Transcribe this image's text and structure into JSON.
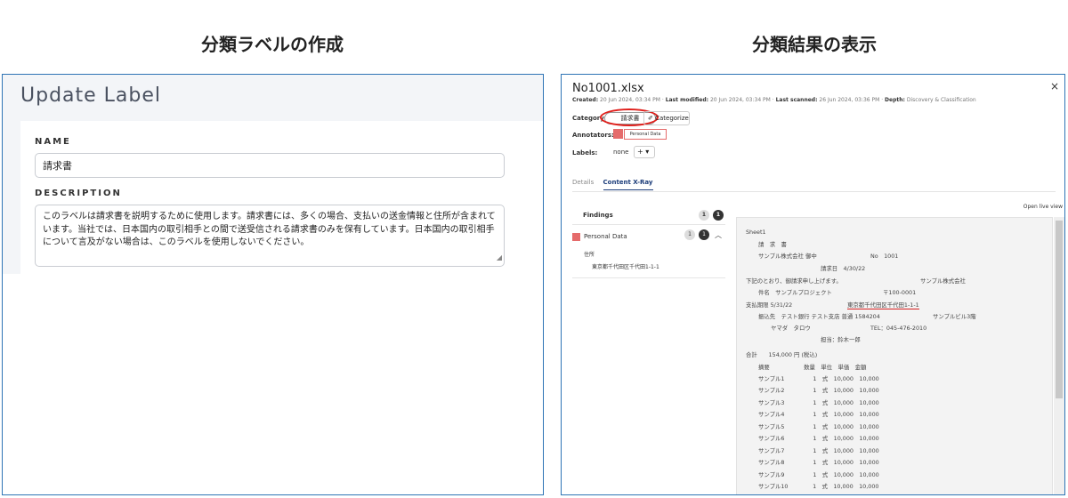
{
  "captions": {
    "left": "分類ラベルの作成",
    "right": "分類結果の表示"
  },
  "update_label": {
    "title": "Update Label",
    "name_label": "NAME",
    "name_value": "請求書",
    "description_label": "DESCRIPTION",
    "description_value": "このラベルは請求書を説明するために使用します。請求書には、多くの場合、支払いの送金情報と住所が含まれています。当社では、日本国内の取引相手との間で送受信される請求書のみを保有しています。日本国内の取引相手について言及がない場合は、このラベルを使用しないでください。"
  },
  "file_view": {
    "close": "×",
    "file_name": "No1001.xlsx",
    "meta": {
      "created_label": "Created:",
      "created": "20 Jun 2024, 03:34 PM",
      "modified_label": "Last modified:",
      "modified": "20 Jun 2024, 03:34 PM",
      "scanned_label": "Last scanned:",
      "scanned": "26 Jun 2024, 03:36 PM",
      "depth_label": "Depth:",
      "depth": "Discovery & Classification"
    },
    "category_label": "Category:",
    "category_value": "請求書",
    "categorize": "✐ Categorize",
    "annotators_label": "Annotators:",
    "annotator": "Personal Data",
    "labels_label": "Labels:",
    "labels_value": "none",
    "labels_add": "+ ▾",
    "tabs": [
      "Details",
      "Content X-Ray"
    ],
    "open_live_view": "Open live view",
    "findings": {
      "header": "Findings",
      "count_a": "1",
      "count_b": "1",
      "item_name": "Personal Data",
      "item_count_a": "1",
      "item_count_b": "1",
      "chevron": "︿",
      "address_label": "住所",
      "address_value": "東京都千代田区千代田1-1-1"
    },
    "document_lines": [
      "Sheet1",
      "請　求　書",
      "サンプル株式会社 御中",
      "No　1001",
      "請求日　4/30/22",
      "下記のとおり、御請求申し上げます。",
      "サンプル株式会社",
      "件名　サンプルプロジェクト",
      "〒100-0001",
      "支払期限 5/31/22",
      "東京都千代田区千代田1-1-1",
      "振込先　テスト銀行 テスト支店 普通 1584204",
      "サンプルビル3階",
      "ヤマダ　タロウ",
      "TEL：045-476-2010",
      "担当：鈴木一郎",
      "合計　　154,000 円 (税込)",
      "摘要　　　　　　数量　単位　単価　金額",
      "サンプル1　　　　　1　式　10,000　10,000",
      "サンプル2　　　　　1　式　10,000　10,000",
      "サンプル3　　　　　1　式　10,000　10,000",
      "サンプル4　　　　　1　式　10,000　10,000",
      "サンプル5　　　　　1　式　10,000　10,000",
      "サンプル6　　　　　1　式　10,000　10,000",
      "サンプル7　　　　　1　式　10,000　10,000",
      "サンプル8　　　　　1　式　10,000　10,000",
      "サンプル9　　　　　1　式　10,000　10,000",
      "サンプル10　　　　 1　式　10,000　10,000"
    ]
  },
  "colors": {
    "panel_border": "#2e74b5",
    "annotation": "#e56b6b",
    "highlight_ring": "#e0201c"
  }
}
